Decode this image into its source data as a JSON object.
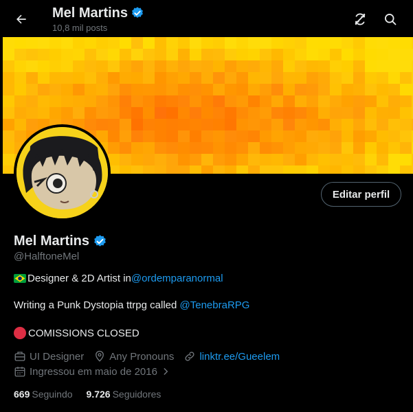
{
  "header": {
    "name": "Mel Martins",
    "posts": "10,8 mil posts"
  },
  "profile": {
    "display_name": "Mel Martins",
    "handle": "@HalftoneMel",
    "edit_label": "Editar perfil",
    "verified_color": "#1d9bf0",
    "banner_color": "#ffd400",
    "avatar_bg": "#f6d21a"
  },
  "bio": {
    "line1_text": "Designer & 2D Artist in ",
    "line1_link": "@ordemparanormal",
    "line2_text": "Writing a Punk Dystopia ttrpg called ",
    "line2_link": "@TenebraRPG",
    "line3_text": "COMISSIONS CLOSED"
  },
  "meta": {
    "job": "UI Designer",
    "pronouns": "Any Pronouns",
    "website": "linktr.ee/Gueelem",
    "joined": "Ingressou em maio de 2016"
  },
  "stats": {
    "following_count": "669",
    "following_label": "Seguindo",
    "followers_count": "9.726",
    "followers_label": "Seguidores"
  },
  "icons": {
    "back": "arrow-left-icon",
    "refresh": "refresh-slash-icon",
    "search": "search-icon",
    "verified": "verified-badge-icon",
    "job": "briefcase-icon",
    "location": "location-pin-icon",
    "link": "link-icon",
    "calendar": "calendar-icon",
    "chevron": "chevron-right-icon"
  },
  "colors": {
    "link": "#1d9bf0",
    "muted": "#71767b",
    "text": "#e7e9ea"
  }
}
